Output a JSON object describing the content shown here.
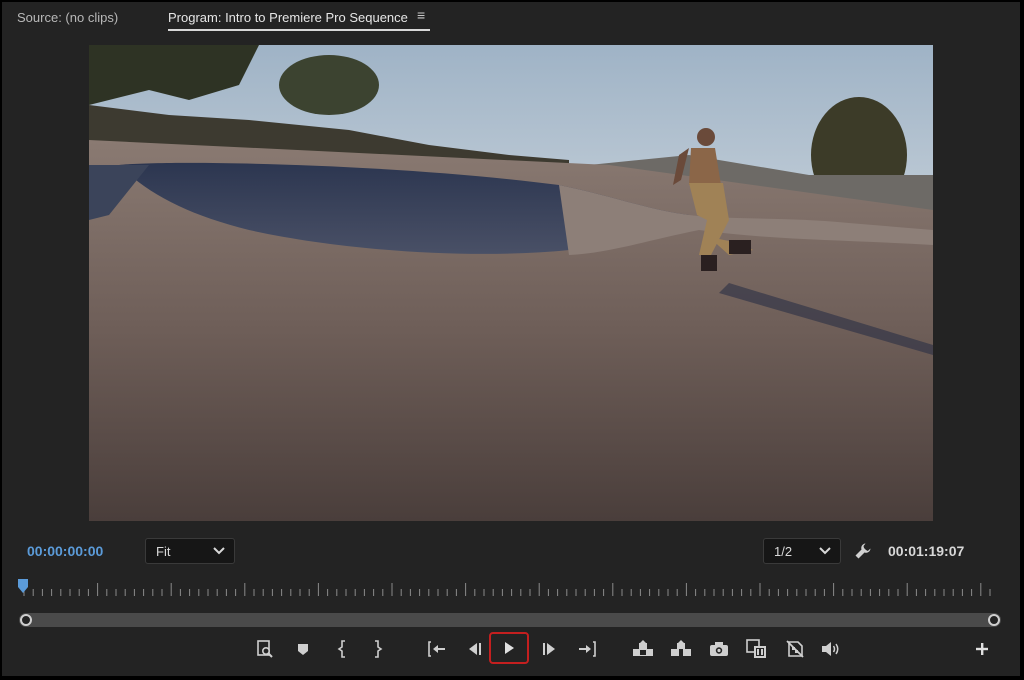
{
  "tabs": {
    "source": "Source: (no clips)",
    "program": "Program: Intro to Premiere Pro Sequence",
    "menu_glyph": "≡"
  },
  "viewer": {
    "scene": "skater-in-skatepark-bowl"
  },
  "controls_bar": {
    "current_timecode": "00:00:00:00",
    "duration_timecode": "00:01:19:07",
    "zoom": "Fit",
    "resolution": "1/2",
    "settings_icon": "wrench-icon"
  },
  "colors": {
    "current_timecode": "#5b9bd9",
    "playhead": "#5b9bd9",
    "play_highlight": "#c41f1f",
    "panel_bg": "#232323"
  },
  "transport": [
    {
      "name": "export-frame-icon"
    },
    {
      "name": "add-marker-icon"
    },
    {
      "name": "mark-in-icon"
    },
    {
      "name": "mark-out-icon"
    },
    {
      "name": "go-to-in-icon"
    },
    {
      "name": "step-back-icon"
    },
    {
      "name": "play-icon"
    },
    {
      "name": "step-forward-icon"
    },
    {
      "name": "go-to-out-icon"
    },
    {
      "name": "lift-icon"
    },
    {
      "name": "extract-icon"
    },
    {
      "name": "camera-icon"
    },
    {
      "name": "comparison-view-icon"
    },
    {
      "name": "proxy-toggle-icon"
    },
    {
      "name": "volume-icon"
    },
    {
      "name": "add-button-icon"
    }
  ]
}
